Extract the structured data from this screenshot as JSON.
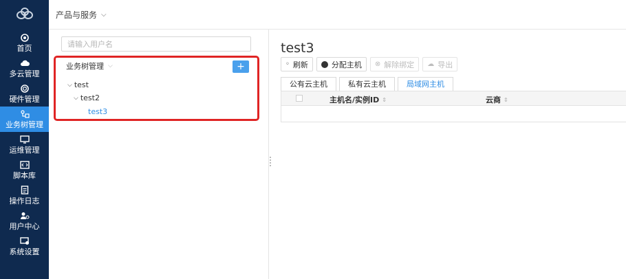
{
  "header": {
    "product_menu": "产品与服务"
  },
  "nav": {
    "items": [
      {
        "label": "首页",
        "icon": "home-icon"
      },
      {
        "label": "多云管理",
        "icon": "cloud-icon"
      },
      {
        "label": "硬件管理",
        "icon": "hardware-icon"
      },
      {
        "label": "业务树管理",
        "icon": "business-tree-icon",
        "active": true
      },
      {
        "label": "运维管理",
        "icon": "monitor-icon"
      },
      {
        "label": "脚本库",
        "icon": "script-icon"
      },
      {
        "label": "操作日志",
        "icon": "log-icon"
      },
      {
        "label": "用户中心",
        "icon": "user-icon"
      },
      {
        "label": "系统设置",
        "icon": "settings-icon"
      }
    ],
    "accent": "#2f8de4",
    "background": "#0f2a4f"
  },
  "left_panel": {
    "search_placeholder": "请输入用户名",
    "tree_title": "业务树管理",
    "add_label": "+",
    "tree": [
      {
        "label": "test",
        "level": 0
      },
      {
        "label": "test2",
        "level": 1
      },
      {
        "label": "test3",
        "level": 2,
        "selected": true
      }
    ]
  },
  "main": {
    "title": "test3",
    "toolbar": {
      "refresh": "刷新",
      "assign_host": "分配主机",
      "unbind": "解除绑定",
      "export": "导出"
    },
    "tabs": [
      {
        "label": "公有云主机"
      },
      {
        "label": "私有云主机"
      },
      {
        "label": "局域网主机",
        "active": true
      }
    ],
    "table": {
      "columns": [
        "主机名/实例ID",
        "云商"
      ]
    }
  },
  "highlight_color": "#e02424"
}
